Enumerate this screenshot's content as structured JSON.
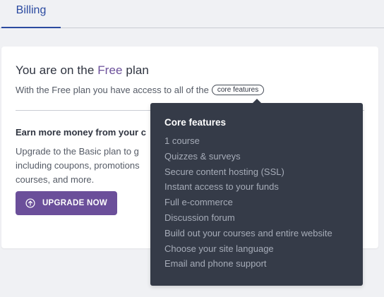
{
  "tabs": {
    "billing": "Billing"
  },
  "plan": {
    "title_prefix": "You are on the ",
    "plan_name": "Free",
    "title_suffix": " plan",
    "description": "With the Free plan you have access to all of the",
    "features_link": "core features"
  },
  "upsell": {
    "title": "Earn more money from your c",
    "description": "Upgrade to the Basic plan to g including coupons, promotions courses, and more.",
    "button_label": "UPGRADE NOW"
  },
  "tooltip": {
    "title": "Core features",
    "items": [
      "1 course",
      "Quizzes & surveys",
      "Secure content hosting (SSL)",
      "Instant access to your funds",
      "Full e-commerce",
      "Discussion forum",
      "Build out your courses and entire website",
      "Choose your site language",
      "Email and phone support"
    ]
  },
  "colors": {
    "accent": "#6b4f9a",
    "tab_active": "#2b4aa0",
    "tooltip_bg": "#353b48",
    "page_bg": "#f0f1f4"
  },
  "icons": {
    "upgrade": "arrow-up-circle-icon"
  }
}
